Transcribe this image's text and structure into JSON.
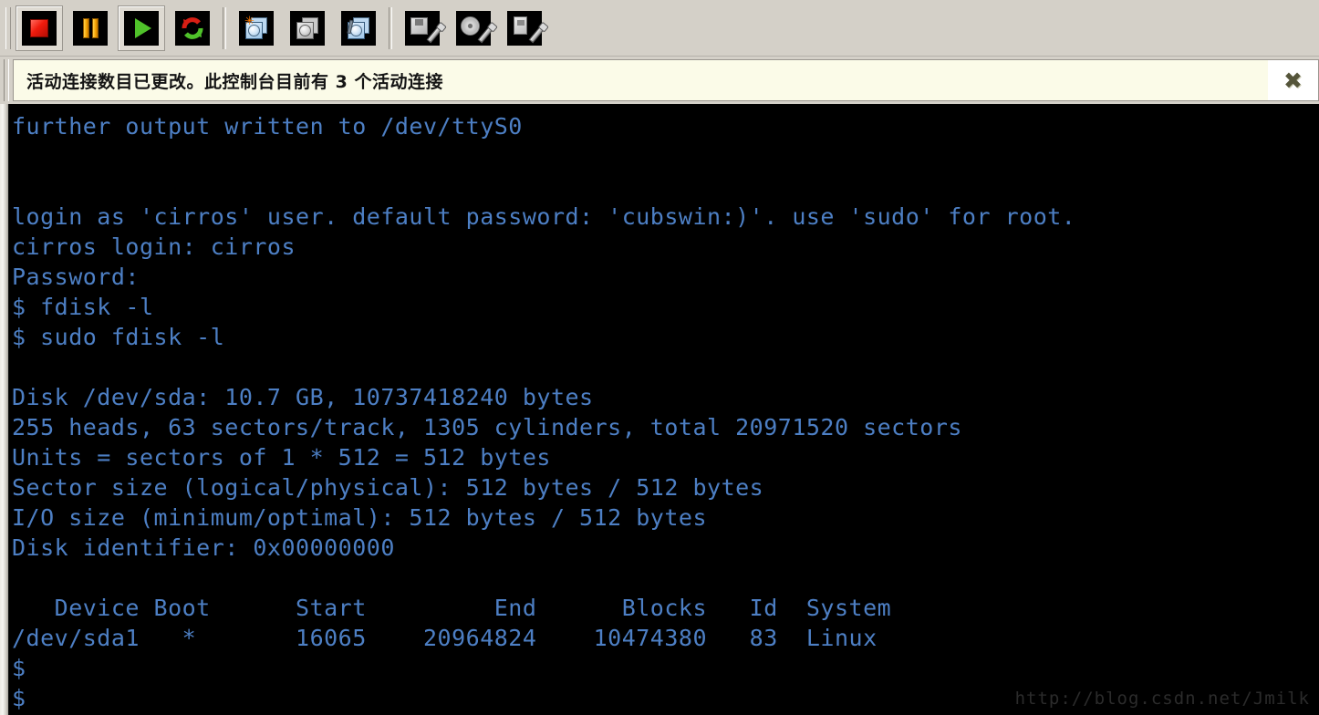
{
  "toolbar": {
    "groups": [
      {
        "buttons": [
          {
            "name": "stop-button",
            "icon": "stop-icon",
            "label": "Stop",
            "active": false
          },
          {
            "name": "pause-button",
            "icon": "pause-icon",
            "label": "Pause",
            "active": false
          },
          {
            "name": "run-button",
            "icon": "play-icon",
            "label": "Run",
            "active": true
          },
          {
            "name": "reset-button",
            "icon": "refresh-icon",
            "label": "Reset",
            "active": false
          }
        ]
      },
      {
        "buttons": [
          {
            "name": "new-console-button",
            "icon": "console-new-icon",
            "label": "New Console",
            "active": false
          },
          {
            "name": "screenshot-button",
            "icon": "console-capture-icon",
            "label": "Screenshot",
            "active": false
          },
          {
            "name": "console-settings-button",
            "icon": "console-settings-icon",
            "label": "Console Settings",
            "active": false
          }
        ]
      },
      {
        "buttons": [
          {
            "name": "floppy-settings-button",
            "icon": "floppy-wrench-icon",
            "label": "Floppy Settings",
            "active": false
          },
          {
            "name": "cd-settings-button",
            "icon": "cd-wrench-icon",
            "label": "CD Settings",
            "active": false
          },
          {
            "name": "usb-settings-button",
            "icon": "usb-wrench-icon",
            "label": "USB Settings",
            "active": false
          }
        ]
      }
    ]
  },
  "notification": {
    "message": "活动连接数目已更改。此控制台目前有 3 个活动连接",
    "close_label": "✖",
    "connection_count": "3"
  },
  "terminal": {
    "foreground_color": "#4d7fc4",
    "background_color": "#000000",
    "lines": [
      "further output written to /dev/ttyS0",
      "",
      "",
      "login as 'cirros' user. default password: 'cubswin:)'. use 'sudo' for root.",
      "cirros login: cirros",
      "Password:",
      "$ fdisk -l",
      "$ sudo fdisk -l",
      "",
      "Disk /dev/sda: 10.7 GB, 10737418240 bytes",
      "255 heads, 63 sectors/track, 1305 cylinders, total 20971520 sectors",
      "Units = sectors of 1 * 512 = 512 bytes",
      "Sector size (logical/physical): 512 bytes / 512 bytes",
      "I/O size (minimum/optimal): 512 bytes / 512 bytes",
      "Disk identifier: 0x00000000",
      "",
      "   Device Boot      Start         End      Blocks   Id  System",
      "/dev/sda1   *       16065    20964824    10474380   83  Linux",
      "$",
      "$"
    ],
    "disk_table": {
      "headers": [
        "Device Boot",
        "Start",
        "End",
        "Blocks",
        "Id",
        "System"
      ],
      "rows": [
        [
          "/dev/sda1   *",
          "16065",
          "20964824",
          "10474380",
          "83",
          "Linux"
        ]
      ]
    },
    "disk_info": {
      "device": "/dev/sda",
      "size_gb": "10.7 GB",
      "size_bytes": "10737418240",
      "heads": "255",
      "sectors_per_track": "63",
      "cylinders": "1305",
      "total_sectors": "20971520",
      "unit_bytes": "512",
      "sector_size_logical": "512",
      "sector_size_physical": "512",
      "io_size_minimum": "512",
      "io_size_optimal": "512",
      "identifier": "0x00000000"
    }
  },
  "watermark": {
    "text": "http://blog.csdn.net/Jmilk"
  }
}
